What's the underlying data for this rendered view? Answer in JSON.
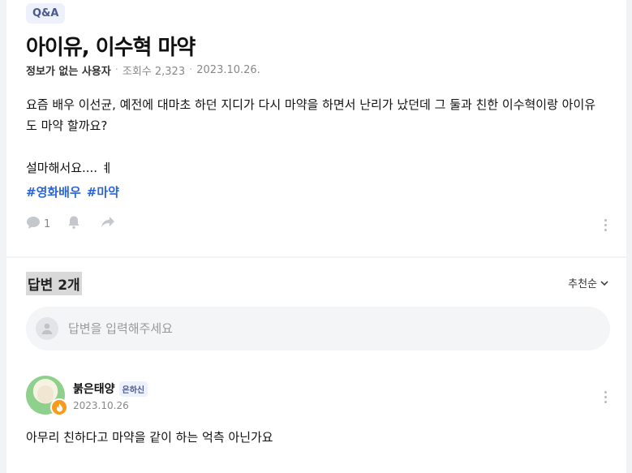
{
  "question": {
    "tag": "Q&A",
    "title": "아이유, 이수혁 마약",
    "author": "정보가 없는 사용자",
    "views": "조회수 2,323",
    "date": "2023.10.26.",
    "body_line1": "요즘 배우 이선균, 예전에 대마초 하던 지디가 다시 마약을 하면서 난리가 났던데 그 둘과 친한 이수혁이랑 아이유",
    "body_line2": "도 마약 할까요?",
    "body_line3": "설마해서요.... ㅖ",
    "hashtags": [
      "#영화배우",
      "#마약"
    ],
    "comment_count": "1"
  },
  "answers": {
    "title": "답변 2개",
    "sort_label": "추천순",
    "input_placeholder": "답변을 입력해주세요",
    "items": [
      {
        "name": "붉은태양",
        "level": "은하신",
        "date": "2023.10.26",
        "text": "아무리 친하다고 마약을 같이 하는 억측 아닌가요"
      }
    ]
  },
  "icons": {
    "comment": "comment-icon",
    "like": "bell-icon",
    "share": "share-icon",
    "more": "more-vertical-icon",
    "user": "user-icon",
    "chevron": "chevron-down-icon",
    "flame": "flame-icon"
  },
  "colors": {
    "hashtag": "#2a66d8",
    "tag_bg": "#eef1fb",
    "badge": "#f79a1e"
  }
}
